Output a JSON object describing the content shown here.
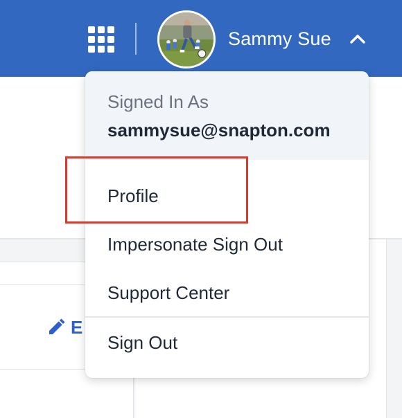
{
  "header": {
    "apps_icon": "grid-icon",
    "user_name": "Sammy Sue",
    "avatar_icon": "user-avatar",
    "chevron_icon": "chevron-up-icon",
    "bg_color": "#3268c0"
  },
  "background": {
    "edit_label": "E",
    "edit_icon": "pencil-icon"
  },
  "dropdown": {
    "signed_in_label": "Signed In As",
    "email": "sammysue@snapton.com",
    "items": [
      {
        "label": "Profile"
      },
      {
        "label": "Impersonate Sign Out"
      },
      {
        "label": "Support Center"
      },
      {
        "label": "Sign Out"
      }
    ]
  },
  "annotation": {
    "highlight_color": "#d93a2e"
  }
}
